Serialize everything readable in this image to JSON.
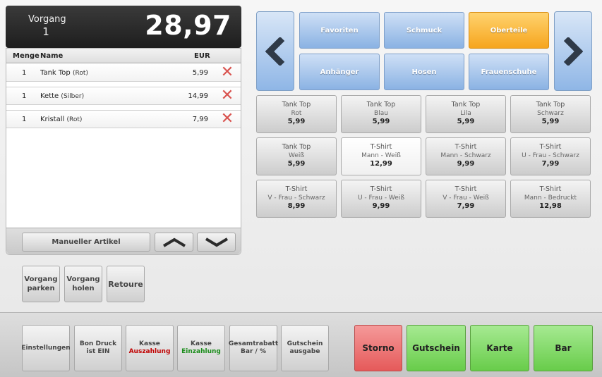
{
  "header": {
    "vorgang_label": "Vorgang",
    "vorgang_number": "1",
    "total": "28,97"
  },
  "list": {
    "col_menge": "Menge",
    "col_name": "Name",
    "col_eur": "EUR",
    "rows": [
      {
        "qty": "1",
        "name": "Tank Top",
        "variant": "(Rot)",
        "price": "5,99"
      },
      {
        "qty": "1",
        "name": "Kette",
        "variant": "(Silber)",
        "price": "14,99"
      },
      {
        "qty": "1",
        "name": "Kristall",
        "variant": "(Rot)",
        "price": "7,99"
      }
    ],
    "manual_label": "Manueller Artikel"
  },
  "vorgang_buttons": {
    "park_l1": "Vorgang",
    "park_l2": "parken",
    "holen_l1": "Vorgang",
    "holen_l2": "holen",
    "retoure": "Retoure"
  },
  "categories": [
    {
      "label": "Favoriten",
      "active": false
    },
    {
      "label": "Schmuck",
      "active": false
    },
    {
      "label": "Oberteile",
      "active": true
    },
    {
      "label": "Anhänger",
      "active": false
    },
    {
      "label": "Hosen",
      "active": false
    },
    {
      "label": "Frauenschuhe",
      "active": false
    }
  ],
  "products": [
    {
      "name": "Tank Top",
      "variant": "Rot",
      "price": "5,99"
    },
    {
      "name": "Tank Top",
      "variant": "Blau",
      "price": "5,99"
    },
    {
      "name": "Tank Top",
      "variant": "Lila",
      "price": "5,99"
    },
    {
      "name": "Tank Top",
      "variant": "Schwarz",
      "price": "5,99"
    },
    {
      "name": "Tank Top",
      "variant": "Weiß",
      "price": "5,99"
    },
    {
      "name": "T-Shirt",
      "variant": "Mann - Weiß",
      "price": "12,99"
    },
    {
      "name": "T-Shirt",
      "variant": "Mann - Schwarz",
      "price": "9,99"
    },
    {
      "name": "T-Shirt",
      "variant": "U - Frau - Schwarz",
      "price": "7,99"
    },
    {
      "name": "T-Shirt",
      "variant": "V - Frau - Schwarz",
      "price": "8,99"
    },
    {
      "name": "T-Shirt",
      "variant": "U - Frau - Weiß",
      "price": "9,99"
    },
    {
      "name": "T-Shirt",
      "variant": "V - Frau - Weiß",
      "price": "7,99"
    },
    {
      "name": "T-Shirt",
      "variant": "Mann - Bedruckt",
      "price": "12,98"
    }
  ],
  "function_buttons": [
    {
      "l1": "Einstellungen",
      "l2": "",
      "l2_color": ""
    },
    {
      "l1": "Bon Druck",
      "l2": "ist EIN",
      "l2_color": ""
    },
    {
      "l1": "Kasse",
      "l2": "Auszahlung",
      "l2_color": "red"
    },
    {
      "l1": "Kasse",
      "l2": "Einzahlung",
      "l2_color": "green"
    },
    {
      "l1": "Gesamtrabatt",
      "l2": "Bar / %",
      "l2_color": ""
    },
    {
      "l1": "Gutschein",
      "l2": "ausgabe",
      "l2_color": ""
    }
  ],
  "payment": {
    "storno": "Storno",
    "gutschein": "Gutschein",
    "karte": "Karte",
    "bar": "Bar"
  },
  "colors": {
    "active_category": "#f6a51e",
    "category": "#8ab2e3",
    "storno": "#e55a5a",
    "pay": "#68cc4a",
    "total_bg": "#1e1e1e"
  }
}
